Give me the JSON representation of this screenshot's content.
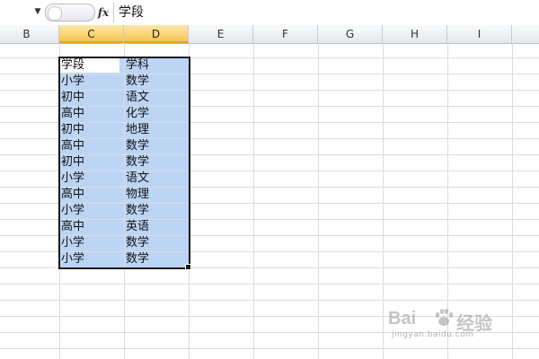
{
  "formula_bar": {
    "namebox_arrow": "▼",
    "fx_label": "fx",
    "content": "学段"
  },
  "columns": [
    {
      "label": "B",
      "selected": false
    },
    {
      "label": "C",
      "selected": true
    },
    {
      "label": "D",
      "selected": true
    },
    {
      "label": "E",
      "selected": false
    },
    {
      "label": "F",
      "selected": false
    },
    {
      "label": "G",
      "selected": false
    },
    {
      "label": "H",
      "selected": false
    },
    {
      "label": "I",
      "selected": false
    }
  ],
  "sheet": {
    "header": [
      "学段",
      "学科"
    ],
    "rows": [
      [
        "小学",
        "数学"
      ],
      [
        "初中",
        "语文"
      ],
      [
        "高中",
        "化学"
      ],
      [
        "初中",
        "地理"
      ],
      [
        "高中",
        "数学"
      ],
      [
        "初中",
        "数学"
      ],
      [
        "小学",
        "语文"
      ],
      [
        "高中",
        "物理"
      ],
      [
        "小学",
        "数学"
      ],
      [
        "高中",
        "英语"
      ],
      [
        "小学",
        "数学"
      ],
      [
        "小学",
        "数学"
      ]
    ]
  },
  "colors": {
    "selection_fill": "#bcd5f5",
    "header_selected": "#f6c453",
    "grid_line": "#dadcdf"
  },
  "watermark": {
    "logo": "Bai",
    "brand": "经验",
    "url": "jingyan.baidu.com"
  }
}
